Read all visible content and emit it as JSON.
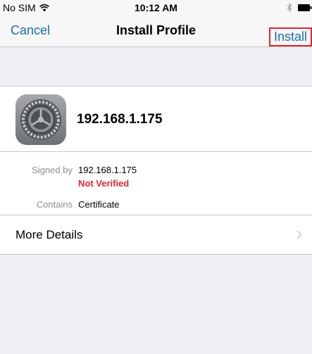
{
  "status_bar": {
    "carrier": "No SIM",
    "time": "10:12 AM",
    "wifi_icon": "wifi-icon",
    "bluetooth_icon": "bluetooth-icon",
    "battery_icon": "battery-icon"
  },
  "nav": {
    "cancel_label": "Cancel",
    "title": "Install Profile",
    "install_label": "Install",
    "install_highlight_color": "#e0262e"
  },
  "profile": {
    "name": "192.168.1.175",
    "icon": "settings-gear-icon"
  },
  "details": {
    "signed_by_label": "Signed by",
    "signed_by_value": "192.168.1.175",
    "verification_status": "Not Verified",
    "contains_label": "Contains",
    "contains_value": "Certificate"
  },
  "more_details": {
    "label": "More Details",
    "icon": "chevron-right-icon"
  },
  "colors": {
    "accent": "#1a6fb0",
    "warning": "#e0262e",
    "background": "#efeff4"
  }
}
